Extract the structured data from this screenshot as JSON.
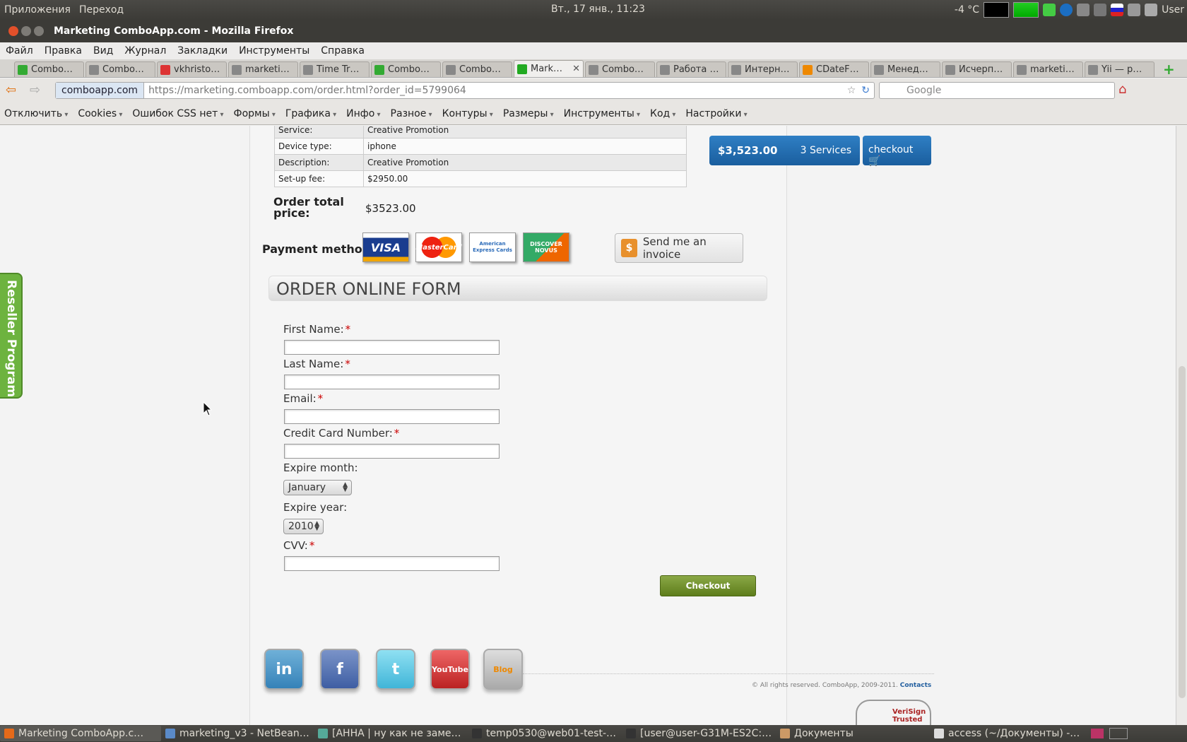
{
  "topbar": {
    "menus": [
      "Приложения",
      "Переход"
    ],
    "clock": "Вт., 17 янв., 11:23",
    "weather": "-4 °C",
    "user": "User"
  },
  "browser": {
    "window_title": "Marketing ComboApp.com - Mozilla Firefox",
    "menu": [
      "Файл",
      "Правка",
      "Вид",
      "Журнал",
      "Закладки",
      "Инструменты",
      "Справка"
    ],
    "tabs": [
      "Combo…",
      "Combo…",
      "vkhristo…",
      "marketi…",
      "Time Tr…",
      "Combo…",
      "Combo…",
      "Mark…",
      "Combo…",
      "Работа …",
      "Интерн…",
      "CDateF…",
      "Менед…",
      "Исчерп…",
      "marketi…",
      "Yii — p…"
    ],
    "active_tab_index": 7,
    "site_badge": "comboapp.com",
    "url": "https://marketing.comboapp.com/order.html?order_id=5799064",
    "search_placeholder": "Google",
    "devtools": [
      "Отключить",
      "Cookies",
      "Ошибок CSS нет",
      "Формы",
      "Графика",
      "Инфо",
      "Разное",
      "Контуры",
      "Размеры",
      "Инструменты",
      "Код",
      "Настройки"
    ]
  },
  "order": {
    "rows": [
      {
        "key": "Service:",
        "value": "Creative Promotion"
      },
      {
        "key": "Device type:",
        "value": "iphone"
      },
      {
        "key": "Description:",
        "value": "Creative Promotion"
      },
      {
        "key": "Set-up fee:",
        "value": "$2950.00"
      }
    ],
    "total_label": "Order total price:",
    "total_value": "$3523.00"
  },
  "payment": {
    "label": "Payment method:",
    "cards": [
      "VISA",
      "MasterCard",
      "American Express Cards",
      "DISCOVER NOVUS"
    ],
    "invoice_button": "Send me an invoice"
  },
  "form": {
    "title": "ORDER ONLINE FORM",
    "first_name": "First Name:",
    "last_name": "Last Name:",
    "email": "Email:",
    "credit_card": "Credit Card Number:",
    "expire_month": "Expire month:",
    "expire_month_value": "January",
    "expire_year": "Expire year:",
    "expire_year_value": "2010",
    "cvv": "CVV:",
    "required_mark": "*",
    "checkout_label": "Checkout"
  },
  "cart": {
    "amount": "$3,523.00",
    "services": "3 Services",
    "checkout": "checkout"
  },
  "reseller": "Reseller Program",
  "footer": {
    "social": [
      "in",
      "f",
      "t",
      "YouTube",
      "Blog"
    ],
    "copyright": "© All rights reserved. ComboApp, 2009-2011.",
    "contacts": "Contacts",
    "verisign": "VeriSign Trusted"
  },
  "taskbar": [
    "Marketing ComboApp.c…",
    "marketing_v3 - NetBean…",
    "[АННА | ну как не заме…",
    "temp0530@web01-test-…",
    "[user@user-G31M-ES2C:…",
    "Документы",
    "access (~/Документы) -…"
  ],
  "colors": {
    "accent_blue": "#1f6aab",
    "checkout_green": "#6d8c2a",
    "reseller_green": "#6db33f",
    "required_red": "#cc0000"
  }
}
